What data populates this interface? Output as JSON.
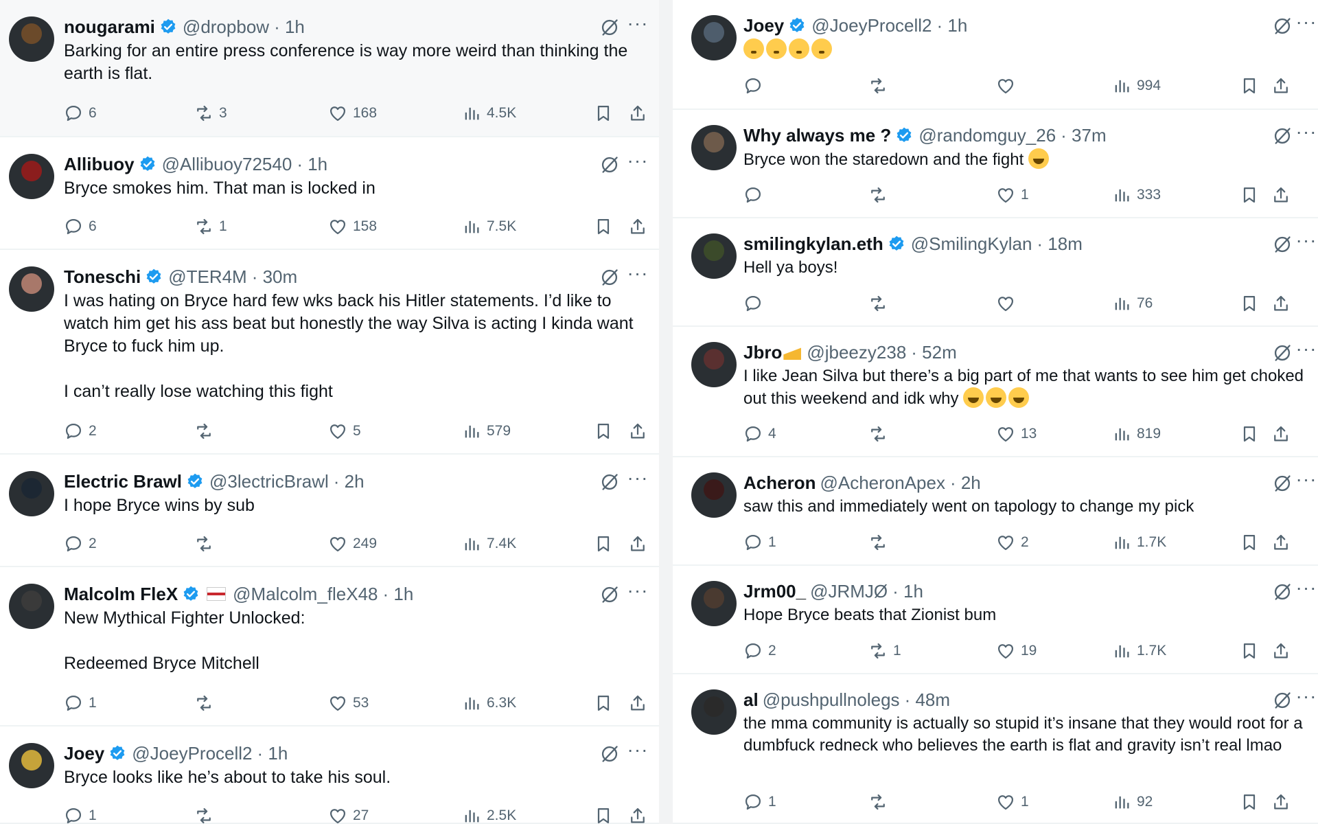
{
  "left_tweets": [
    {
      "name": "nougarami",
      "verified": true,
      "handle": "@dropbow",
      "time": "· 1h",
      "text": "Barking for an entire press conference is way more weird than thinking the earth is flat.",
      "reply": "6",
      "retweet": "3",
      "like": "168",
      "views": "4.5K",
      "highlighted": true
    },
    {
      "name": "Allibuoy",
      "verified": true,
      "handle": "@Allibuoy72540",
      "time": "· 1h",
      "text": "Bryce smokes him. That man is locked in",
      "reply": "6",
      "retweet": "1",
      "like": "158",
      "views": "7.5K"
    },
    {
      "name": "Toneschi",
      "verified": true,
      "handle": "@TER4M",
      "time": "· 30m",
      "text": "I was hating on Bryce hard few wks back his Hitler statements. I’d like to watch him get his ass beat but honestly the way Silva is acting I kinda want Bryce to fuck him up.\n\nI can’t really lose watching this fight",
      "reply": "2",
      "retweet": "",
      "like": "5",
      "views": "579"
    },
    {
      "name": "Electric Brawl",
      "verified": true,
      "handle": "@3lectricBrawl",
      "time": "· 2h",
      "text": "I hope Bryce wins by sub",
      "reply": "2",
      "retweet": "",
      "like": "249",
      "views": "7.4K"
    },
    {
      "name": "Malcolm FleX",
      "verified": true,
      "flag": true,
      "handle": "@Malcolm_fleX48",
      "time": "· 1h",
      "text": "New Mythical Fighter Unlocked:\n\nRedeemed Bryce Mitchell",
      "reply": "1",
      "retweet": "",
      "like": "53",
      "views": "6.3K"
    },
    {
      "name": "Joey",
      "verified": true,
      "handle": "@JoeyProcell2",
      "time": "· 1h",
      "text": "Bryce looks like he’s about to take his soul.",
      "reply": "1",
      "retweet": "",
      "like": "27",
      "views": "2.5K"
    }
  ],
  "right_tweets": [
    {
      "name": "Joey",
      "verified": true,
      "handle": "@JoeyProcell2",
      "time": "· 1h",
      "text": "",
      "emoji": [
        "flush",
        "flush",
        "flush",
        "flush"
      ],
      "reply": "",
      "retweet": "",
      "like": "",
      "views": "994"
    },
    {
      "name": "Why always me ?",
      "verified": true,
      "handle": "@randomguy_26",
      "time": "· 37m",
      "text": "Bryce won the staredown and the fight ",
      "emoji": [
        "laugh"
      ],
      "reply": "",
      "retweet": "",
      "like": "1",
      "views": "333"
    },
    {
      "name": "smilingkylan.eth",
      "verified": true,
      "handle": "@SmilingKylan",
      "time": "· 18m",
      "text": "Hell ya boys!",
      "reply": "",
      "retweet": "",
      "like": "",
      "views": "76"
    },
    {
      "name": "Jbro",
      "verified": false,
      "cheese": true,
      "handle": "@jbeezy238",
      "time": "· 52m",
      "text": "I like Jean Silva but there’s a big part of me that wants to see him get choked out this weekend and idk why ",
      "emoji": [
        "laugh",
        "laugh",
        "laugh"
      ],
      "reply": "4",
      "retweet": "",
      "like": "13",
      "views": "819"
    },
    {
      "name": "Acheron",
      "verified": false,
      "handle": "@AcheronApex",
      "time": "· 2h",
      "text": "saw this and immediately went on tapology to change my pick",
      "reply": "1",
      "retweet": "",
      "like": "2",
      "views": "1.7K"
    },
    {
      "name": "Jrm00_",
      "verified": false,
      "handle": "@JRMJØ",
      "time": "· 1h",
      "text": "Hope Bryce beats that Zionist bum",
      "reply": "2",
      "retweet": "1",
      "like": "19",
      "views": "1.7K"
    },
    {
      "name": "al",
      "verified": false,
      "handle": "@pushpullnolegs",
      "time": "· 48m",
      "text": "the mma community is actually so stupid it’s insane that they would root for a dumbfuck redneck who believes the earth is flat and gravity isn’t real lmao",
      "reply": "1",
      "retweet": "",
      "like": "1",
      "views": "92"
    }
  ],
  "colors": {
    "accent": "#1d9bf0",
    "muted": "#536471",
    "text": "#0f1419",
    "border": "#eff3f4"
  },
  "avatars": [
    "#6b4a2a",
    "#8b1d1d",
    "#a8786a",
    "#1c2733",
    "#3a3a3a",
    "#c5a33a",
    "#4e5d6c",
    "#6d5a4a",
    "#3b4a2a",
    "#5a3030",
    "#3a1a1a",
    "#4a3a30",
    "#2a2a2a"
  ]
}
